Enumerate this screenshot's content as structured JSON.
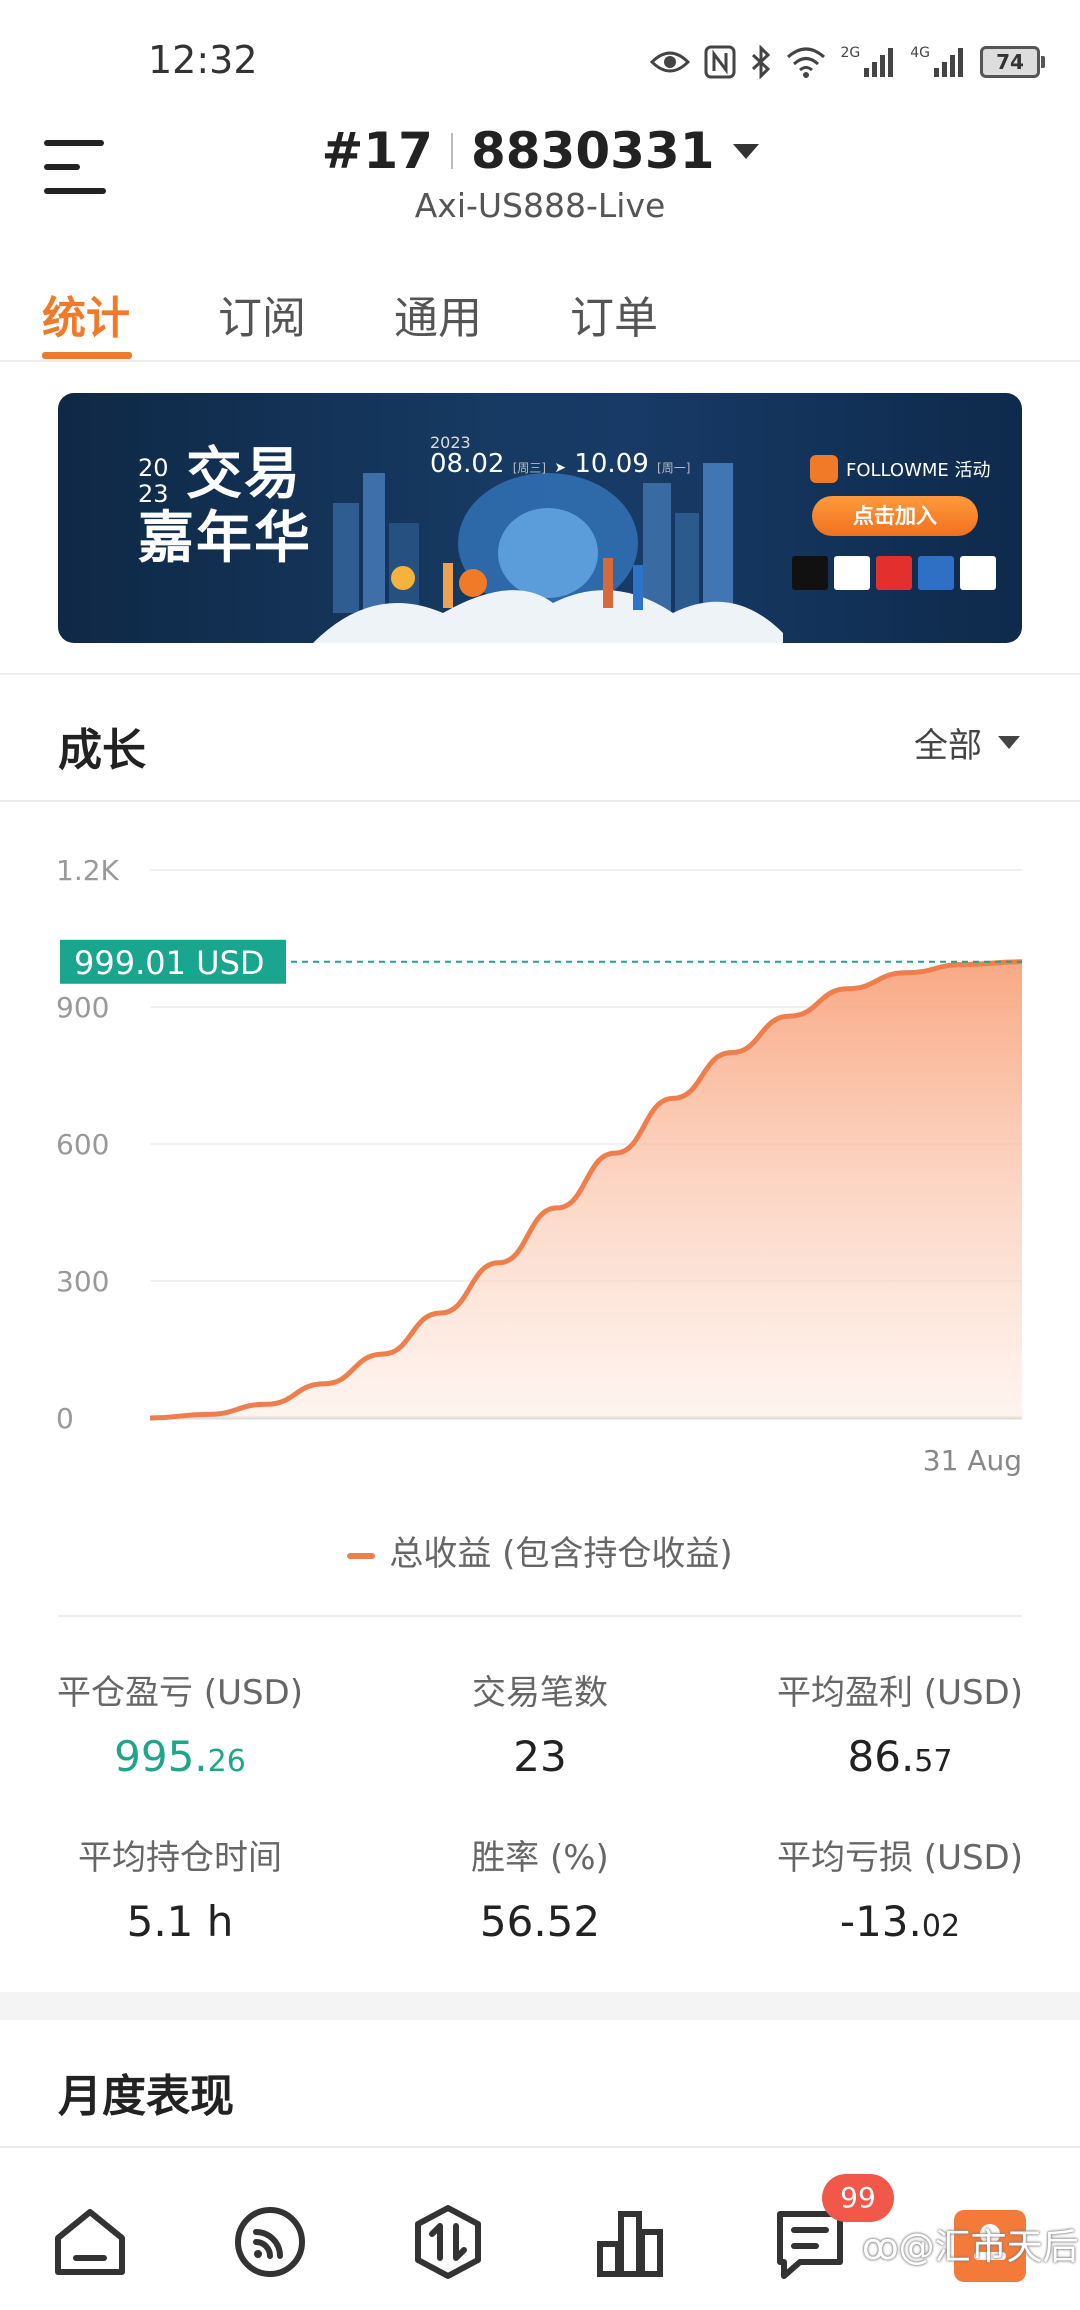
{
  "status_bar": {
    "time": "12:32",
    "battery": "74",
    "signal_1": "2G",
    "signal_2": "4G"
  },
  "header": {
    "account_number": "#17",
    "account_id": "8830331",
    "server": "Axi-US888-Live"
  },
  "tabs": [
    {
      "label": "统计",
      "active": true
    },
    {
      "label": "订阅",
      "active": false
    },
    {
      "label": "通用",
      "active": false
    },
    {
      "label": "订单",
      "active": false
    }
  ],
  "banner": {
    "title_line1": "交易",
    "title_line2": "嘉年华",
    "year_top": "20",
    "year_bottom": "23",
    "date_year": "2023",
    "date_start": "08.02",
    "date_start_day": "[周三]",
    "date_end": "10.09",
    "date_end_day": "[周一]",
    "brand": "FOLLOWME 活动",
    "cta": "点击加入"
  },
  "growth": {
    "title": "成长",
    "filter": "全部"
  },
  "chart_data": {
    "type": "area",
    "y_ticks": [
      "1.2K",
      "900",
      "600",
      "300",
      "0"
    ],
    "ylim": [
      0,
      1200
    ],
    "x_label_end": "31 Aug",
    "current_value_label": "999.01 USD",
    "current_value": 999.01,
    "series": [
      {
        "name": "总收益 (包含持仓收益)",
        "values": [
          0,
          8,
          30,
          75,
          140,
          230,
          340,
          460,
          580,
          700,
          800,
          880,
          940,
          975,
          993,
          999.01
        ]
      }
    ],
    "colors": {
      "line": "#ee7e4c",
      "fill": "#f9b08c",
      "marker": "#1aa68e"
    }
  },
  "legend": {
    "label": "总收益 (包含持仓收益)"
  },
  "stats": [
    {
      "label": "平仓盈亏 (USD)",
      "int": "995.",
      "frac": "26",
      "color": "green"
    },
    {
      "label": "交易笔数",
      "int": "23",
      "frac": "",
      "color": "default"
    },
    {
      "label": "平均盈利 (USD)",
      "int": "86.",
      "frac": "57",
      "color": "default"
    },
    {
      "label": "平均持仓时间",
      "int": "5.1 h",
      "frac": "",
      "color": "default"
    },
    {
      "label": "胜率 (%)",
      "int": "56.52",
      "frac": "",
      "color": "default"
    },
    {
      "label": "平均亏损 (USD)",
      "int": "-13.",
      "frac": "02",
      "color": "default"
    }
  ],
  "monthly": {
    "title": "月度表现"
  },
  "bottom_nav": {
    "badge": "99",
    "watermark": "汇市天后"
  }
}
